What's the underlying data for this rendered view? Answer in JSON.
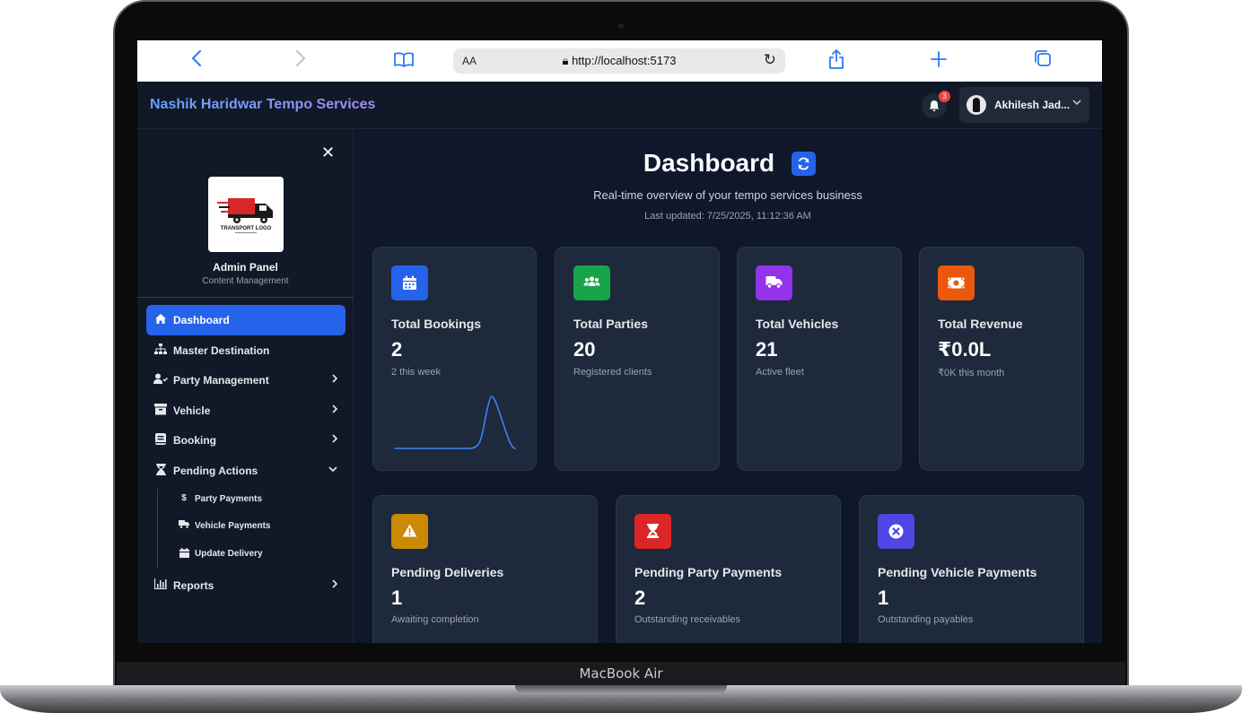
{
  "device": {
    "label": "MacBook Air"
  },
  "browser": {
    "url": "http://localhost:5173",
    "text_size_label": "AA"
  },
  "header": {
    "brand": "Nashik Haridwar Tempo Services",
    "notification_count": "3",
    "user_name": "Akhilesh Jad..."
  },
  "sidebar": {
    "logo_text": "TRANSPORT LOGO",
    "title": "Admin Panel",
    "subtitle": "Content Management",
    "items": [
      {
        "label": "Dashboard",
        "icon": "home-icon",
        "active": true
      },
      {
        "label": "Master Destination",
        "icon": "sitemap-icon"
      },
      {
        "label": "Party Management",
        "icon": "user-check-icon"
      },
      {
        "label": "Vehicle",
        "icon": "archive-icon"
      },
      {
        "label": "Booking",
        "icon": "book-icon"
      },
      {
        "label": "Pending Actions",
        "icon": "hourglass-icon",
        "expanded": true
      },
      {
        "label": "Reports",
        "icon": "bar-chart-icon"
      }
    ],
    "sub_items": [
      {
        "label": "Party Payments",
        "icon": "dollar-icon"
      },
      {
        "label": "Vehicle Payments",
        "icon": "truck-icon"
      },
      {
        "label": "Update Delivery",
        "icon": "calendar-icon"
      }
    ]
  },
  "main": {
    "title": "Dashboard",
    "subtitle": "Real-time overview of your tempo services business",
    "last_updated": "Last updated: 7/25/2025, 11:12:36 AM",
    "stats": [
      {
        "title": "Total Bookings",
        "value": "2",
        "note": "2 this week",
        "icon": "calendar-icon",
        "color": "#2563eb"
      },
      {
        "title": "Total Parties",
        "value": "20",
        "note": "Registered clients",
        "icon": "users-icon",
        "color": "#16a34a"
      },
      {
        "title": "Total Vehicles",
        "value": "21",
        "note": "Active fleet",
        "icon": "truck-icon",
        "color": "#9333ea"
      },
      {
        "title": "Total Revenue",
        "value": "₹0.0L",
        "note": "₹0K this month",
        "icon": "money-bill-icon",
        "color": "#ea580c"
      }
    ],
    "pending": [
      {
        "title": "Pending Deliveries",
        "value": "1",
        "note": "Awaiting completion",
        "icon": "warning-icon",
        "color": "#ca8a04"
      },
      {
        "title": "Pending Party Payments",
        "value": "2",
        "note": "Outstanding receivables",
        "icon": "hourglass-icon",
        "color": "#dc2626"
      },
      {
        "title": "Pending Vehicle Payments",
        "value": "1",
        "note": "Outstanding payables",
        "icon": "times-circle-icon",
        "color": "#4f46e5"
      }
    ]
  }
}
